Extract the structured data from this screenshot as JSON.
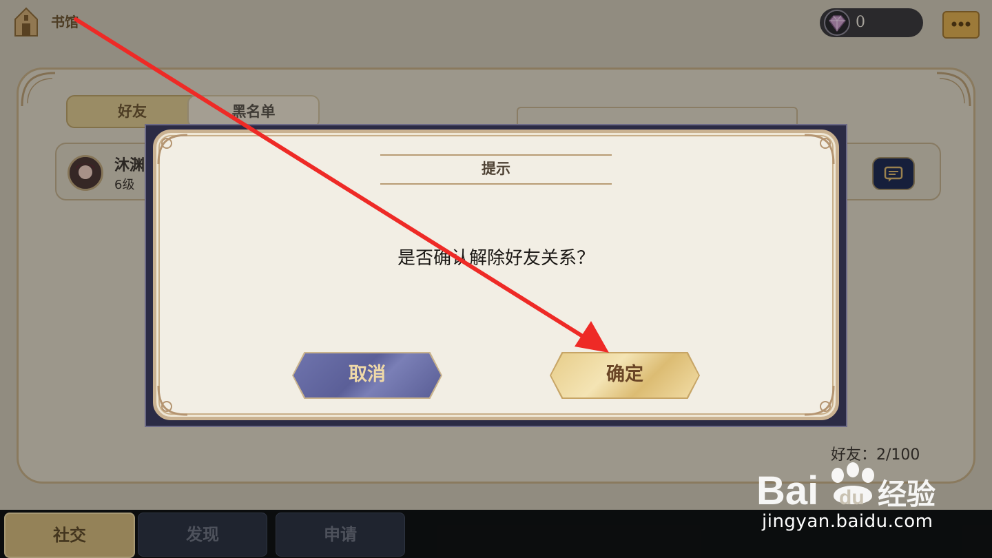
{
  "header": {
    "title": "书馆",
    "currency_value": "0"
  },
  "tabs": {
    "friends": "好友",
    "blacklist": "黑名单"
  },
  "friend": {
    "name": "沐渊",
    "level": "6级"
  },
  "friend_count": "好友：2/100",
  "bottom_nav": {
    "social": "社交",
    "discover": "发现",
    "request": "申请"
  },
  "dialog": {
    "title": "提示",
    "message": "是否确认解除好友关系？",
    "cancel": "取消",
    "confirm": "确定"
  },
  "watermark": {
    "url": "jingyan.baidu.com"
  },
  "colors": {
    "annotation_arrow": "#ee2a26",
    "confirm_button": "#ead08f",
    "cancel_button": "#656aa4",
    "dialog_frame": "#2b2b45"
  },
  "icons": {
    "home": "house-icon",
    "gem": "gem-icon",
    "chat": "chat-bubble-icon"
  }
}
